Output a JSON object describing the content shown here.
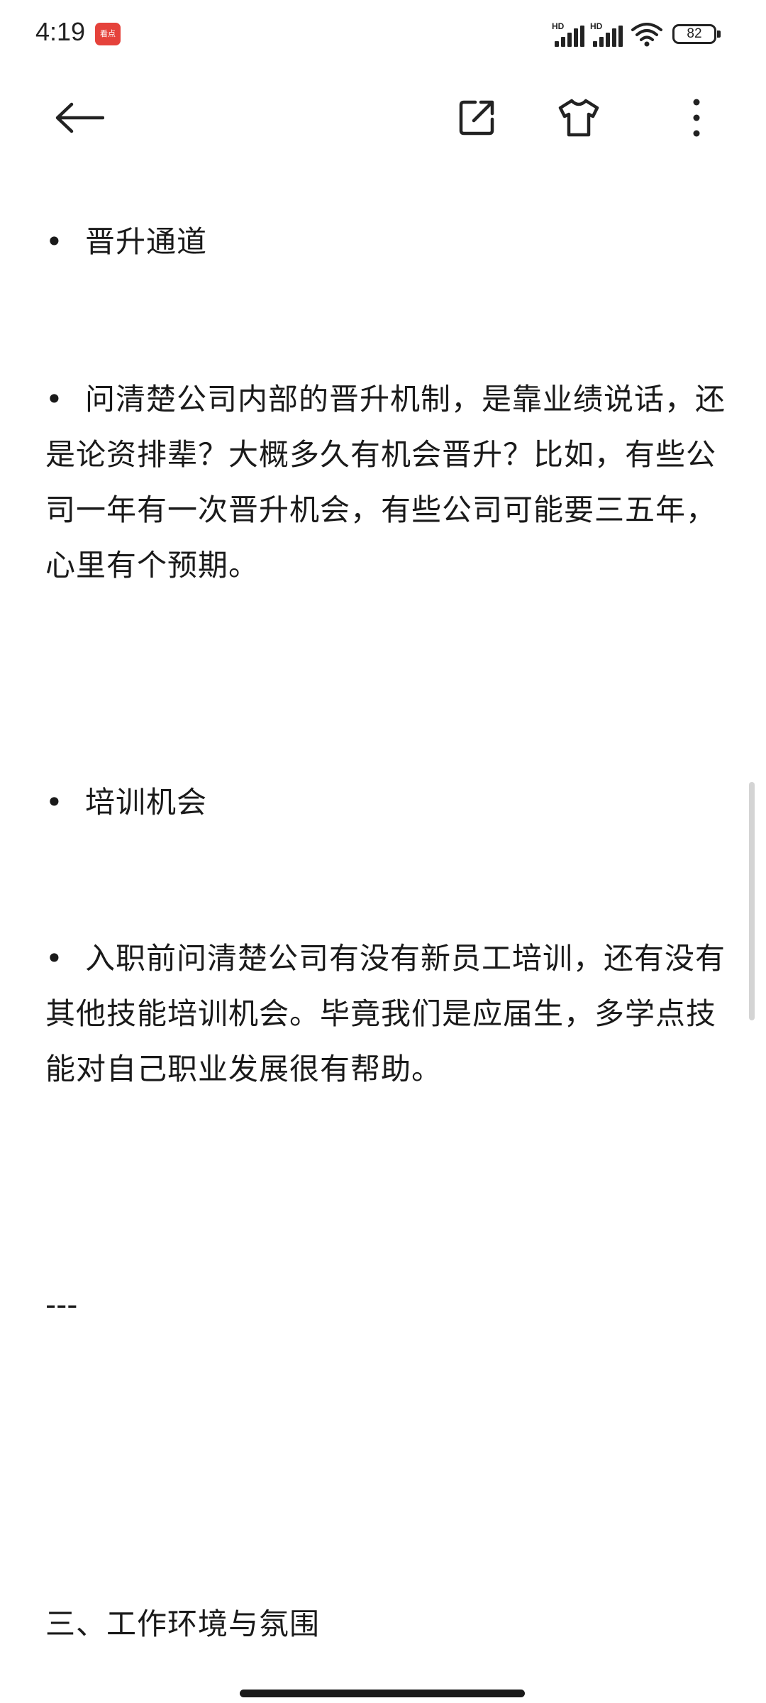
{
  "status_bar": {
    "time": "4:19",
    "notification_app_label": "看点",
    "signal_labels": [
      "HD",
      "HD"
    ],
    "battery_level": "82"
  },
  "toolbar": {
    "back_icon": "arrow-left-icon",
    "share_icon": "external-link-icon",
    "theme_icon": "tshirt-icon",
    "more_icon": "more-vertical-icon"
  },
  "article": {
    "bullet_symbol": "•",
    "item1_title": "晋升通道",
    "item1_body": "问清楚公司内部的晋升机制，是靠业绩说话，还是论资排辈？大概多久有机会晋升？比如，有些公司一年有一次晋升机会，有些公司可能要三五年，心里有个预期。",
    "item2_title": "培训机会",
    "item2_body": "入职前问清楚公司有没有新员工培训，还有没有其他技能培训机会。毕竟我们是应届生，多学点技能对自己职业发展很有帮助。",
    "separator": "---",
    "section3_title": "三、工作环境与氛围"
  }
}
